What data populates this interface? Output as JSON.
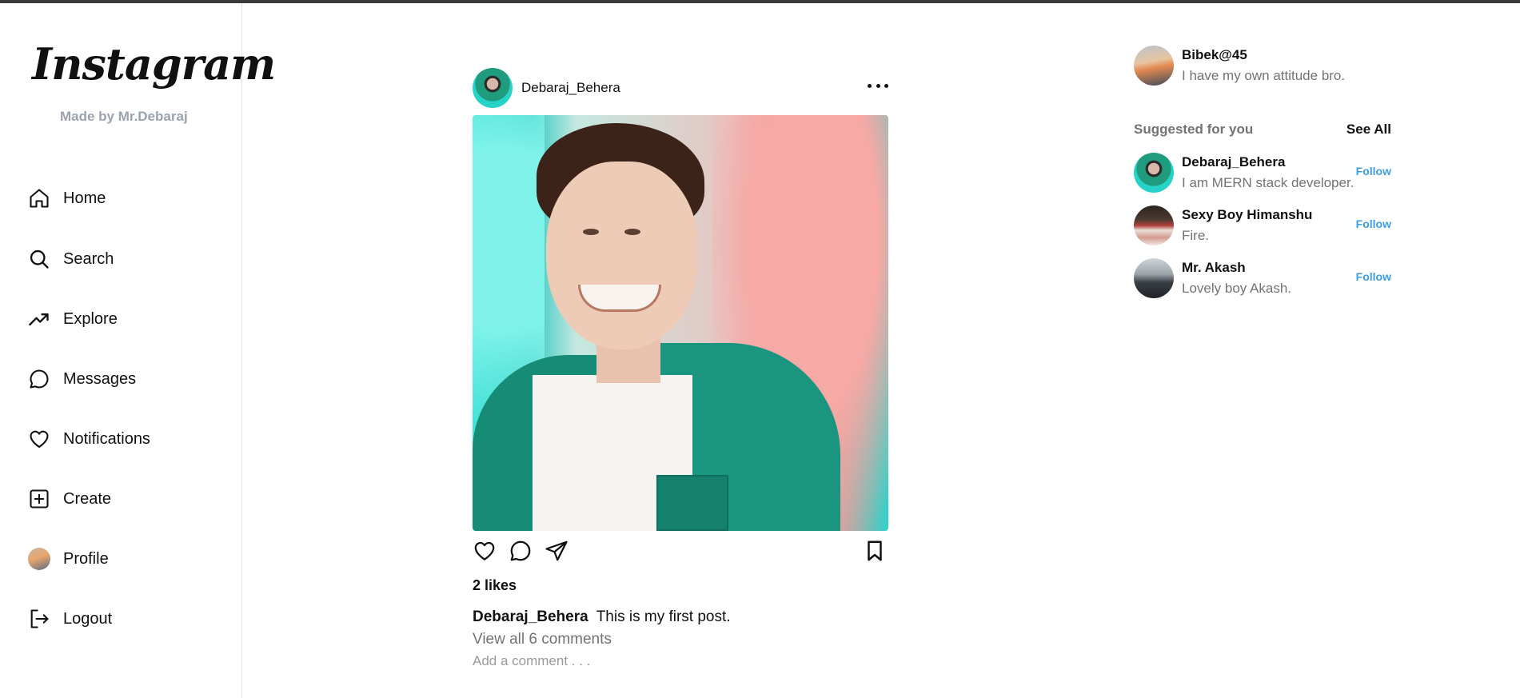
{
  "app": {
    "logo": "Instagram",
    "made_by": "Made by Mr.Debaraj"
  },
  "sidebar": {
    "items": [
      {
        "label": "Home",
        "icon": "home-icon"
      },
      {
        "label": "Search",
        "icon": "search-icon"
      },
      {
        "label": "Explore",
        "icon": "trending-icon"
      },
      {
        "label": "Messages",
        "icon": "message-icon"
      },
      {
        "label": "Notifications",
        "icon": "heart-icon"
      },
      {
        "label": "Create",
        "icon": "plus-square-icon"
      },
      {
        "label": "Profile",
        "icon": "avatar"
      },
      {
        "label": "Logout",
        "icon": "logout-icon"
      }
    ]
  },
  "post": {
    "username": "Debaraj_Behera",
    "likes": "2 likes",
    "caption_user": "Debaraj_Behera",
    "caption_text": "This is my first post.",
    "view_comments": "View all 6 comments",
    "comment_placeholder": "Add a comment . . ."
  },
  "current_user": {
    "name": "Bibek@45",
    "bio": "I have my own attitude bro."
  },
  "suggestions": {
    "title": "Suggested for you",
    "see_all": "See All",
    "follow_label": "Follow",
    "users": [
      {
        "name": "Debaraj_Behera",
        "bio": "I am MERN stack developer."
      },
      {
        "name": "Sexy Boy Himanshu",
        "bio": "Fire."
      },
      {
        "name": "Mr. Akash",
        "bio": "Lovely boy Akash."
      }
    ]
  },
  "colors": {
    "accent_link": "#3d9ee8",
    "muted_text": "#737373",
    "made_by": "#9aa3af"
  }
}
